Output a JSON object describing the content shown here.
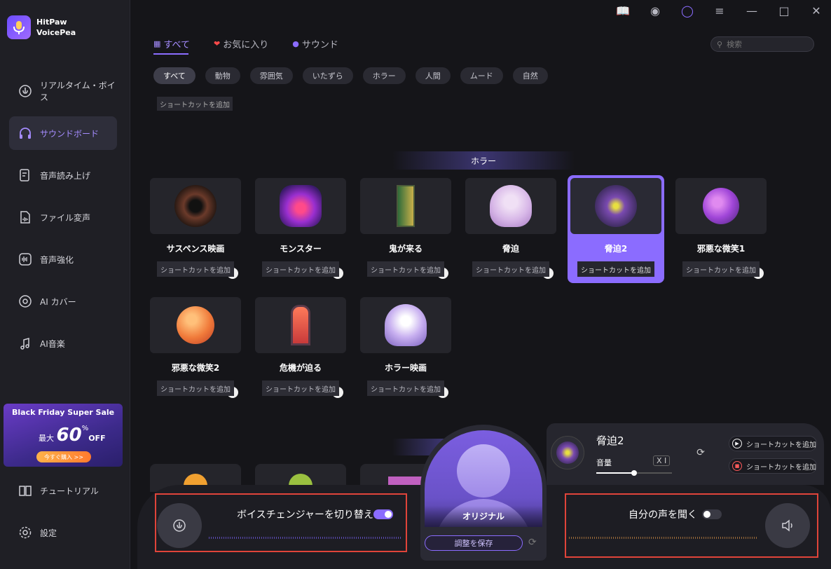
{
  "app": {
    "name_line1": "HitPaw",
    "name_line2": "VoicePea"
  },
  "sidebar": {
    "items": [
      {
        "label": "リアルタイム・ボイス",
        "icon": "realtime-voice-icon"
      },
      {
        "label": "サウンドボード",
        "icon": "headphones-icon",
        "active": true
      },
      {
        "label": "音声読み上げ",
        "icon": "tts-icon"
      },
      {
        "label": "ファイル変声",
        "icon": "file-voice-icon"
      },
      {
        "label": "音声強化",
        "icon": "enhance-icon"
      },
      {
        "label": "AI カバー",
        "icon": "ai-cover-icon"
      },
      {
        "label": "AI音楽",
        "icon": "ai-music-icon"
      },
      {
        "label": "チュートリアル",
        "icon": "book-icon"
      },
      {
        "label": "設定",
        "icon": "gear-icon"
      }
    ],
    "promo": {
      "title": "Black Friday Super Sale",
      "prefix": "最大",
      "number": "60",
      "percent": "%",
      "off": "OFF",
      "button": "今すぐ購入 >>"
    }
  },
  "tabs": [
    {
      "label": "すべて",
      "icon": "grid-icon",
      "active": true
    },
    {
      "label": "お気に入り",
      "icon": "heart-icon"
    },
    {
      "label": "サウンド",
      "icon": "mic-icon"
    }
  ],
  "search": {
    "placeholder": "検索"
  },
  "filters": [
    "すべて",
    "動物",
    "雰囲気",
    "いたずら",
    "ホラー",
    "人間",
    "ムード",
    "自然"
  ],
  "partial_shortcut": "ショートカットを追加",
  "section": {
    "title": "ホラー"
  },
  "cards": [
    {
      "name": "サスペンス映画",
      "shortcut": "ショートカットを追加",
      "color": "#6b3a2a"
    },
    {
      "name": "モンスター",
      "shortcut": "ショートカットを追加",
      "color": "#9a2fd0"
    },
    {
      "name": "鬼が来る",
      "shortcut": "ショートカットを追加",
      "color": "#2f6b3a"
    },
    {
      "name": "脅迫",
      "shortcut": "ショートカットを追加",
      "color": "#d8b8e8"
    },
    {
      "name": "脅迫2",
      "shortcut": "ショートカットを追加",
      "color": "#7a4ab0",
      "selected": true
    },
    {
      "name": "邪悪な微笑1",
      "shortcut": "ショートカットを追加",
      "color": "#a046d8"
    },
    {
      "name": "邪悪な微笑2",
      "shortcut": "ショートカットを追加",
      "color": "#f07a3a"
    },
    {
      "name": "危機が迫る",
      "shortcut": "ショートカットを追加",
      "color": "#c83a3a"
    },
    {
      "name": "ホラー映画",
      "shortcut": "ショートカットを追加",
      "color": "#c8b0f0"
    }
  ],
  "now_playing": {
    "title": "脅迫2",
    "volume_label": "音量",
    "volume_value": "Ⅹ Ⅰ",
    "volume_level": 0.5,
    "play_shortcut": "ショートカットを追加",
    "stop_shortcut": "ショートカットを追加"
  },
  "center": {
    "label": "オリジナル",
    "save_button": "調整を保存"
  },
  "voice_changer": {
    "label": "ボイスチェンジャーを切り替える",
    "enabled": true
  },
  "listen": {
    "label": "自分の声を聞く",
    "enabled": false
  },
  "colors": {
    "accent": "#8b6cff",
    "highlight_box": "#e0443a"
  }
}
